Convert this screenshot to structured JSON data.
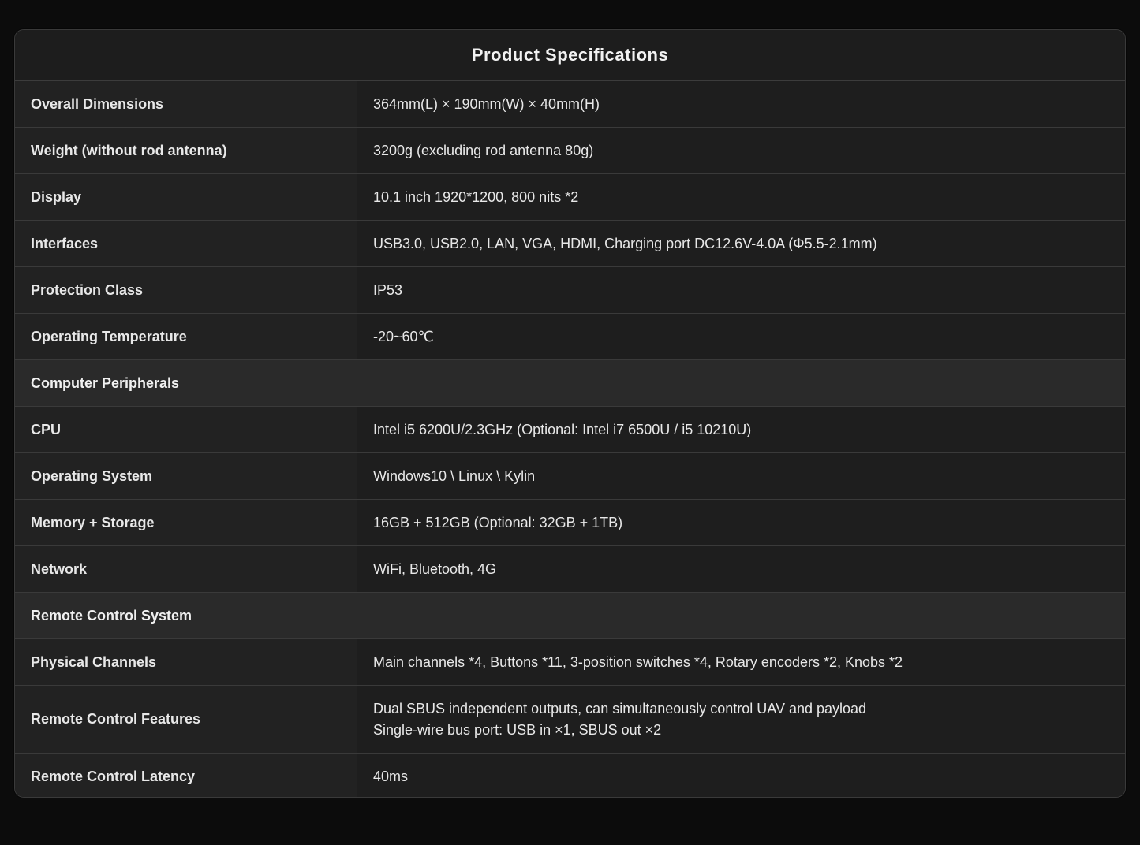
{
  "title": "Product Specifications",
  "rows": [
    {
      "key": "Overall Dimensions",
      "value": "364mm(L) × 190mm(W) × 40mm(H)"
    },
    {
      "key": "Weight (without rod antenna)",
      "value": "3200g (excluding rod antenna 80g)"
    },
    {
      "key": "Display",
      "value": "10.1 inch 1920*1200, 800 nits *2"
    },
    {
      "key": "Interfaces",
      "value": "USB3.0, USB2.0, LAN, VGA, HDMI, Charging port DC12.6V-4.0A (Φ5.5-2.1mm)"
    },
    {
      "key": "Protection Class",
      "value": "IP53"
    },
    {
      "key": "Operating Temperature",
      "value": "-20~60℃"
    }
  ],
  "section_computer": "Computer Peripherals",
  "computer_rows": [
    {
      "key": "CPU",
      "value": "Intel i5 6200U/2.3GHz (Optional: Intel i7 6500U / i5 10210U)"
    },
    {
      "key": "Operating System",
      "value": "Windows10 \\ Linux \\ Kylin"
    },
    {
      "key": "Memory + Storage",
      "value": "16GB + 512GB (Optional: 32GB + 1TB)"
    },
    {
      "key": "Network",
      "value": "WiFi, Bluetooth, 4G"
    }
  ],
  "section_remote": "Remote Control System",
  "remote_rows": [
    {
      "key": "Physical Channels",
      "value": "Main channels *4, Buttons *11, 3-position switches *4, Rotary encoders *2, Knobs *2"
    },
    {
      "key": "Remote Control Features",
      "value_line1": "Dual SBUS independent outputs, can simultaneously control UAV and payload",
      "value_line2": "Single-wire bus port: USB in ×1, SBUS out ×2"
    },
    {
      "key": "Remote Control Latency",
      "value": "40ms"
    }
  ]
}
